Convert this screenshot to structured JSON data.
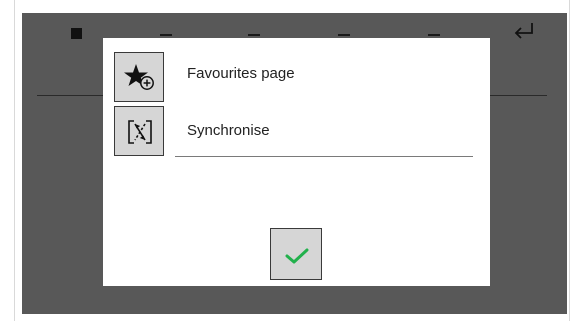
{
  "topbar": {
    "left_icon": "stop-square-icon",
    "right_icon": "enter-return-icon"
  },
  "dialog": {
    "options": [
      {
        "label": "Favourites page",
        "icon": "star-add-icon"
      },
      {
        "label": "Synchronise",
        "icon": "sync-arrows-icon"
      }
    ],
    "confirm_icon": "checkmark-icon",
    "colors": {
      "check": "#22b14c",
      "button_bg": "#d6d6d6",
      "screen_bg": "#585858"
    }
  }
}
